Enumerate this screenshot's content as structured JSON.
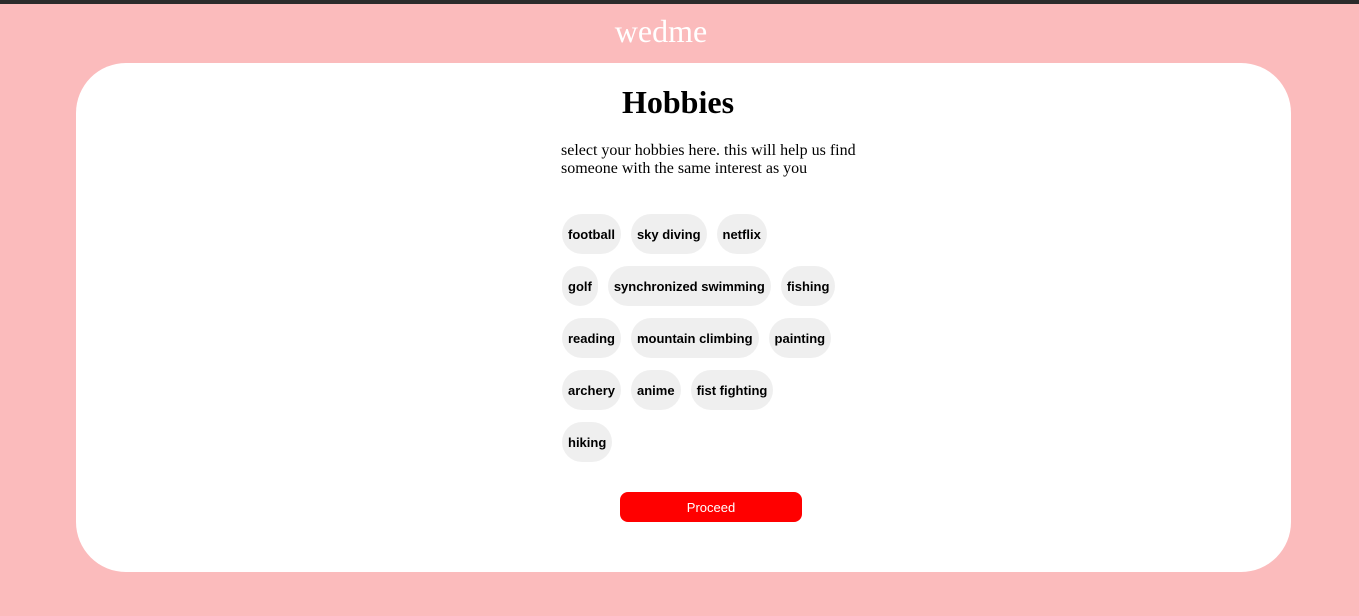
{
  "app": {
    "brand": "wedme"
  },
  "page": {
    "title": "Hobbies",
    "description": "select your hobbies here. this will help us find someone with the same interest as you"
  },
  "hobbies": [
    [
      "football",
      "sky diving",
      "netflix"
    ],
    [
      "golf",
      "synchronized swimming",
      "fishing"
    ],
    [
      "reading",
      "mountain climbing",
      "painting"
    ],
    [
      "archery",
      "anime",
      "fist fighting"
    ],
    [
      "hiking"
    ]
  ],
  "actions": {
    "proceed_label": "Proceed"
  },
  "colors": {
    "background": "#fbbbbc",
    "card": "#ffffff",
    "chip": "#efefef",
    "proceed": "#ff0000"
  }
}
